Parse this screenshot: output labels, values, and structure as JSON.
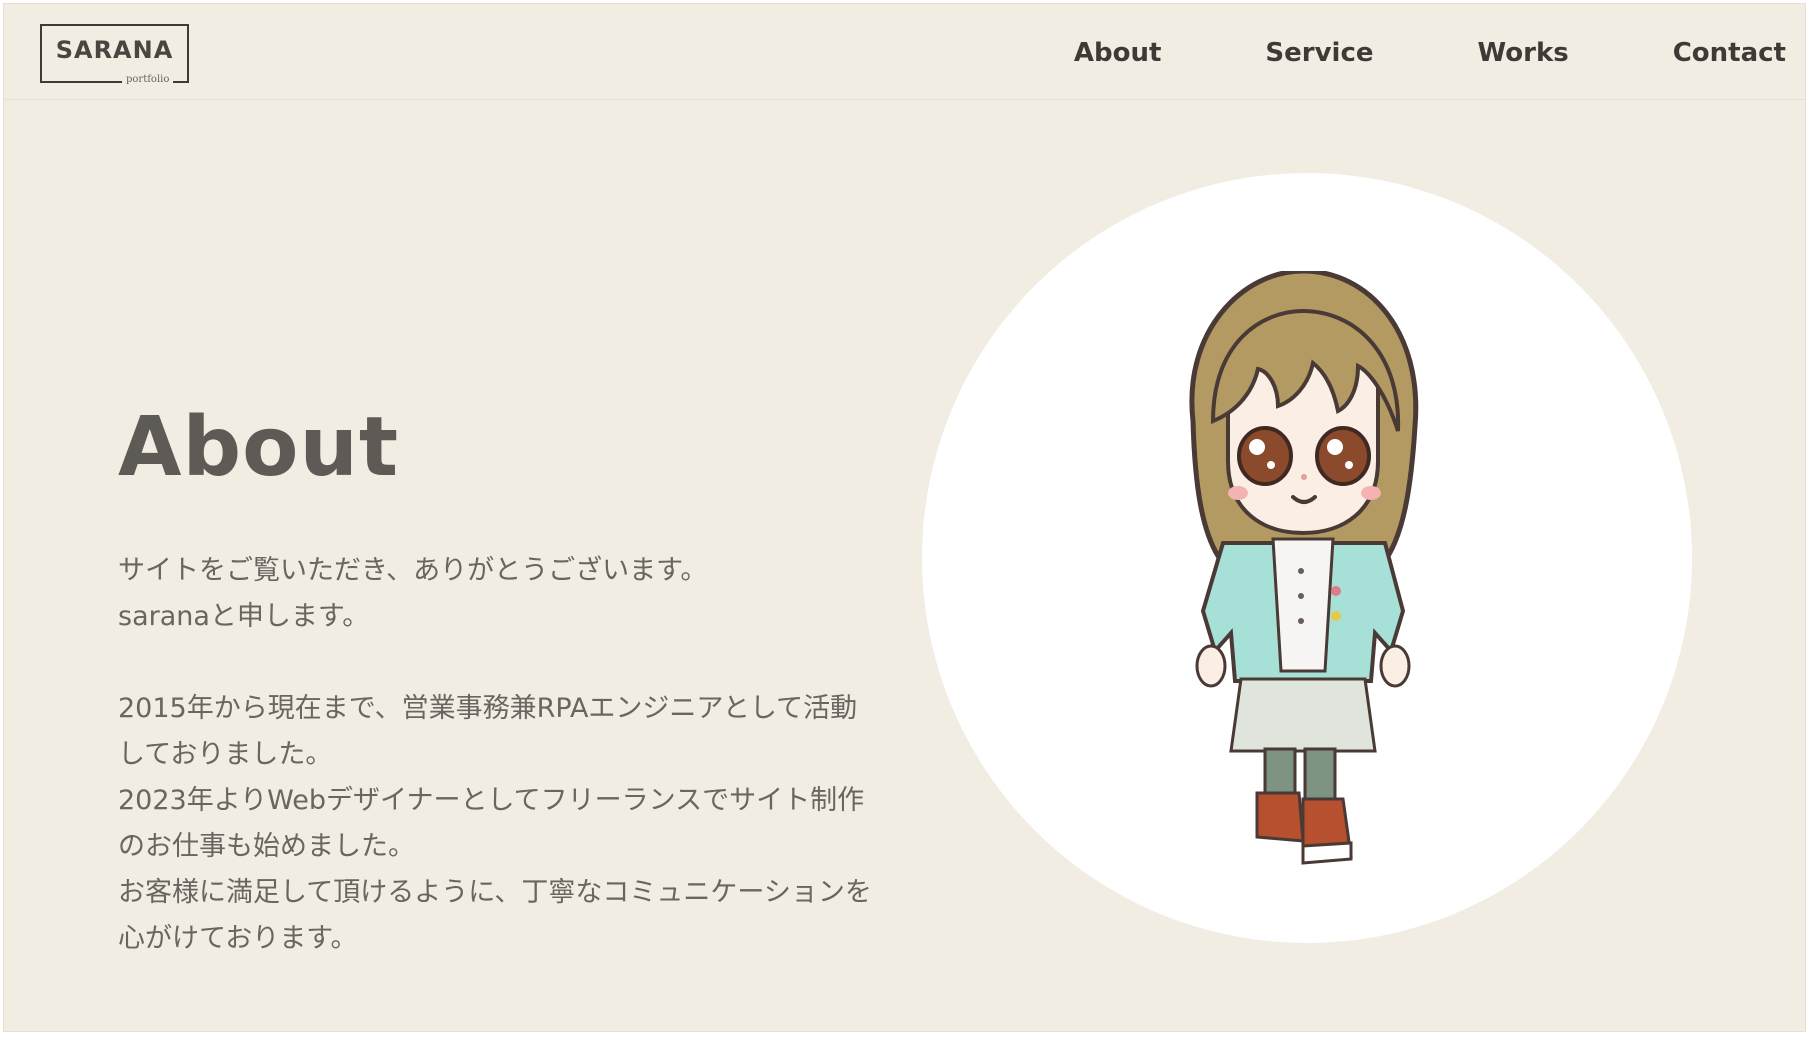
{
  "header": {
    "logo_text": "SARANA",
    "logo_sub": "portfolio",
    "nav": [
      {
        "label": "About"
      },
      {
        "label": "Service"
      },
      {
        "label": "Works"
      },
      {
        "label": "Contact"
      }
    ]
  },
  "main": {
    "title": "About",
    "paragraphs": [
      "サイトをご覧いただき、ありがとうございます。",
      "saranaと申します。",
      "2015年から現在まで、営業事務兼RPAエンジニアとして活動しておりました。",
      "2023年よりWebデザイナーとしてフリーランスでサイト制作のお仕事も始めました。",
      "お客様に満足して頂けるように、丁寧なコミュニケーションを心がけております。"
    ]
  },
  "colors": {
    "background": "#f2ede2",
    "circle": "#ffffff",
    "title": "#5e5a56",
    "text": "#6a6560"
  },
  "icons": {
    "avatar": "chibi-character-illustration"
  }
}
